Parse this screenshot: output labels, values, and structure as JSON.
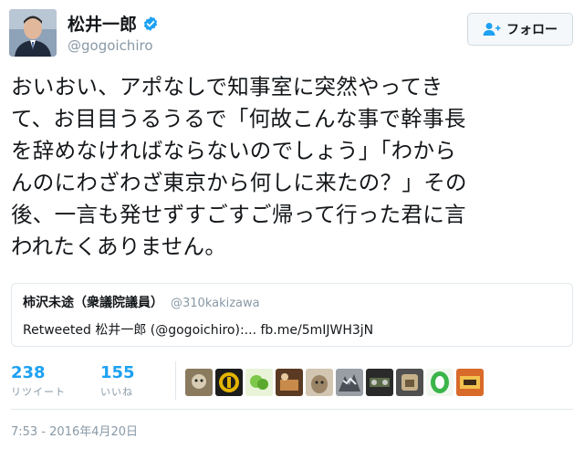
{
  "author": {
    "display_name": "松井一郎",
    "handle": "@gogoichiro",
    "verified_icon": "verified-badge-icon"
  },
  "follow_button": {
    "label": "フォロー",
    "icon": "follow-user-plus-icon"
  },
  "tweet": {
    "lines": [
      "おいおい、アポなしで知事室に突然やってき",
      "て、お目目うるうるで「何故こんな事で幹事長",
      "を辞めなければならないのでしょう」「わから",
      "んのにわざわざ東京から何しに来たの？」その",
      "後、一言も発せずすごすご帰って行った君に言",
      "われたくありません。"
    ]
  },
  "quoted_tweet": {
    "display_name": "柿沢未途（衆議院議員）",
    "handle": "@310kakizawa",
    "body": "Retweeted 松井一郎 (@gogoichiro):... fb.me/5mIJWH3jN"
  },
  "stats": {
    "retweets": {
      "count": "238",
      "label": "リツイート"
    },
    "likes": {
      "count": "155",
      "label": "いいね"
    }
  },
  "timestamp": "7:53 - 2016年4月20日",
  "colors": {
    "accent": "#1da1f2",
    "muted": "#8899a6",
    "border": "#e1e8ed"
  }
}
